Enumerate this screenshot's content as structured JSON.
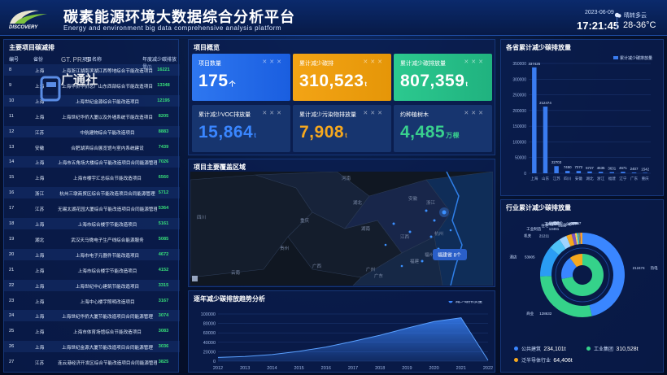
{
  "header": {
    "title": "碳素能源环境大数据综合分析平台",
    "subtitle": "Energy and environment big data comprehensive analysis platform",
    "brand": "DISCOVERY",
    "date": "2023-06-09",
    "time": "17:21:45",
    "weather": "晴转多云",
    "temperature": "28-36°C"
  },
  "watermark": {
    "text": "广通社",
    "sub": "GT. PR.  S"
  },
  "left": {
    "title": "主要项目碳减排",
    "headers": [
      "编号",
      "省份",
      "项目名称",
      "年度减少碳排放量(t)"
    ],
    "rows": [
      [
        "8",
        "上海",
        "上海浙江湖南滨湖江西等地综合节能改造项目",
        "16221"
      ],
      [
        "9",
        "上海",
        "上海华侨华侨总厂山东西部综合节能改造项目",
        "13348"
      ],
      [
        "10",
        "上海",
        "上海世纪金源综合节能改造项目",
        "12195"
      ],
      [
        "11",
        "上海",
        "上海世纪华侨大厦以及外墙系统节能改造项目",
        "8205"
      ],
      [
        "12",
        "江苏",
        "中航建物综合节能改造项目",
        "8883"
      ],
      [
        "13",
        "安徽",
        "合肥湖滨综合展览馆与室内系统建设",
        "7439"
      ],
      [
        "14",
        "上海",
        "上海市五角场大楼综合节能改造项目合同能源管理",
        "7026"
      ],
      [
        "15",
        "上海",
        "上海市楼宇汇总综合节能改造项目",
        "6560"
      ],
      [
        "16",
        "浙江",
        "杭州三墩商贸区综合节能改造项目合同能源管理",
        "5712"
      ],
      [
        "17",
        "江苏",
        "无锡太湖花园大厦综合节能改造项目合同能源管理",
        "5364"
      ],
      [
        "18",
        "上海",
        "上海市综合楼宇节能改造项目",
        "5161"
      ],
      [
        "19",
        "湖北",
        "武汉天马微电子生产线综合能源服务",
        "5085"
      ],
      [
        "20",
        "上海",
        "上海市电子元器件节能改造项目",
        "4672"
      ],
      [
        "21",
        "上海",
        "上海市综合楼宇节能改造项目",
        "4152"
      ],
      [
        "22",
        "上海",
        "上海世纪中心建筑节能改造项目",
        "3315"
      ],
      [
        "23",
        "上海",
        "上海中心楼宇照明改造项目",
        "3167"
      ],
      [
        "24",
        "上海",
        "上海世纪华侨大厦节能改造项目合同能源管理",
        "3074"
      ],
      [
        "25",
        "上海",
        "上海市体育场馆综合节能改造项目",
        "3083"
      ],
      [
        "26",
        "上海",
        "上海世纪金源大厦节能改造项目合同能源管理",
        "3036"
      ],
      [
        "27",
        "江苏",
        "连云港经济开发区综合节能改造项目合同能源管理",
        "3825"
      ]
    ]
  },
  "overview": {
    "title": "项目概览",
    "cards": [
      {
        "label": "项目数量",
        "value": "175",
        "unit": "个"
      },
      {
        "label": "累计减少碳排",
        "value": "310,523",
        "unit": "t"
      },
      {
        "label": "累计减少碳排放量",
        "value": "807,359",
        "unit": "t"
      },
      {
        "label": "累计减少VOC排放量",
        "value": "15,864",
        "unit": "t"
      },
      {
        "label": "累计减少污染物排放量",
        "value": "7,908",
        "unit": "t"
      },
      {
        "label": "约种植树木",
        "value": "4,485",
        "unit": "万棵"
      }
    ]
  },
  "map": {
    "title": "项目主要覆盖区域",
    "badge": "福建省 8个",
    "places": [
      "安徽",
      "浙江",
      "江西",
      "福建",
      "湖北",
      "湖南",
      "广东",
      "河南",
      "重庆",
      "贵州",
      "广西",
      "云南",
      "四川",
      "杭州",
      "福州",
      "广州"
    ]
  },
  "trend": {
    "title": "逐年减少碳排放趋势分析",
    "legend": "减少碳排放量"
  },
  "right1": {
    "title": "各省累计减少碳排放量",
    "legend": "累计减少碳排放量"
  },
  "right2": {
    "title": "行业累计减少碳排放量",
    "labels": [
      "电力",
      "工业制造",
      "工业能源",
      "酒店",
      "商业/写字楼",
      "购物",
      "仓储",
      "住宅",
      "剧院",
      "熟食",
      "热电",
      "办公",
      "商业",
      "机关",
      "酒店",
      "学校",
      "其他",
      "公共建筑",
      "工业集团",
      "泛半导体行业"
    ],
    "legend": [
      {
        "name": "公共建筑",
        "value": "234,101t",
        "color": "#3a86ff"
      },
      {
        "name": "工业集团",
        "value": "310,528t",
        "color": "#35d28a"
      },
      {
        "name": "泛半导体行业",
        "value": "64,406t",
        "color": "#f6a81e"
      }
    ]
  },
  "chart_data": [
    {
      "type": "bar",
      "title": "各省累计减少碳排放量",
      "series": [
        {
          "name": "累计减少碳排放量",
          "values": [
            337425,
            212474,
            22703,
            7450,
            7272,
            5727,
            4635,
            3631,
            4671,
            2407,
            1542
          ]
        }
      ],
      "categories": [
        "上海",
        "山东",
        "江苏",
        "四川",
        "安徽",
        "湖北",
        "浙江",
        "福建",
        "辽宁",
        "广东",
        "重庆"
      ],
      "ylim": [
        0,
        350000
      ],
      "yticks": [
        0,
        50000,
        100000,
        150000,
        200000,
        250000,
        300000,
        350000
      ],
      "legend": "top-right",
      "grid": true
    },
    {
      "type": "area",
      "title": "逐年减少碳排放趋势分析",
      "x": [
        "2012",
        "2013",
        "2014",
        "2015",
        "2016",
        "2017",
        "2018",
        "2019",
        "2020",
        "2021",
        "2022"
      ],
      "series": [
        {
          "name": "减少碳排放量",
          "values": [
            8000,
            10000,
            14000,
            21000,
            30000,
            42000,
            55000,
            70000,
            84000,
            92000,
            2000
          ]
        }
      ],
      "ylim": [
        0,
        100000
      ],
      "yticks": [
        0,
        20000,
        40000,
        60000,
        80000,
        100000
      ],
      "legend": "top-right",
      "grid": true
    },
    {
      "type": "pie",
      "title": "行业累计减少碳排放量",
      "series": [
        {
          "name": "行业",
          "values": [
            212474,
            128632,
            53905,
            21211,
            13461,
            9480,
            5940,
            3408,
            2847,
            1098,
            1211,
            678,
            3667,
            88,
            3
          ]
        }
      ],
      "categories": [
        "热电",
        "商业",
        "酒店",
        "机关",
        "工业制造",
        "住宅",
        "学校",
        "购物",
        "工业能源",
        "电力",
        "办公",
        "剧院",
        "商业",
        "熟食",
        "其他"
      ]
    }
  ]
}
